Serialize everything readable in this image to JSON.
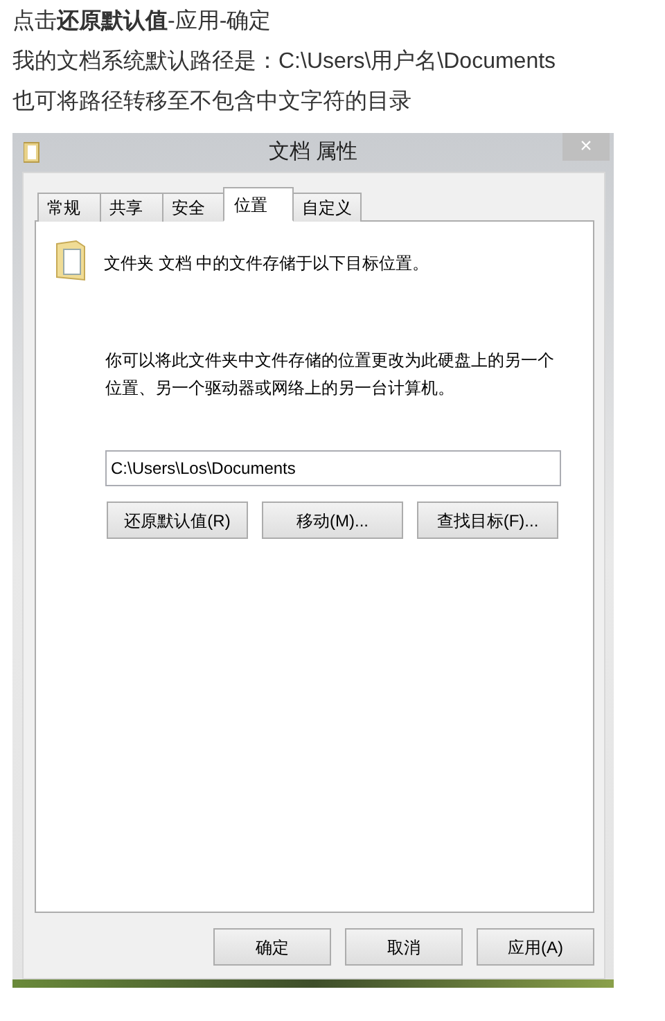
{
  "intro": [
    "点击**还原默认值**-应用-确定",
    "我的文档系统默认路径是：C:\\Users\\用户名\\Documents",
    "也可将路径转移至不包含中文字符的目录"
  ],
  "dialog": {
    "title": "文档 属性",
    "close": "×",
    "tabs": [
      {
        "label": "常规",
        "selected": false
      },
      {
        "label": "共享",
        "selected": false
      },
      {
        "label": "安全",
        "selected": false
      },
      {
        "label": "位置",
        "selected": true
      },
      {
        "label": "自定义",
        "selected": false
      }
    ],
    "description": "文件夹 文档 中的文件存储于以下目标位置。",
    "paragraph": "你可以将此文件夹中文件存储的位置更改为此硬盘上的另一个位置、另一个驱动器或网络上的另一台计算机。",
    "path": "C:\\Users\\Los\\Documents",
    "actions": [
      "还原默认值(R)",
      "移动(M)...",
      "查找目标(F)..."
    ],
    "footer_buttons": [
      "确定",
      "取消",
      "应用(A)"
    ]
  }
}
